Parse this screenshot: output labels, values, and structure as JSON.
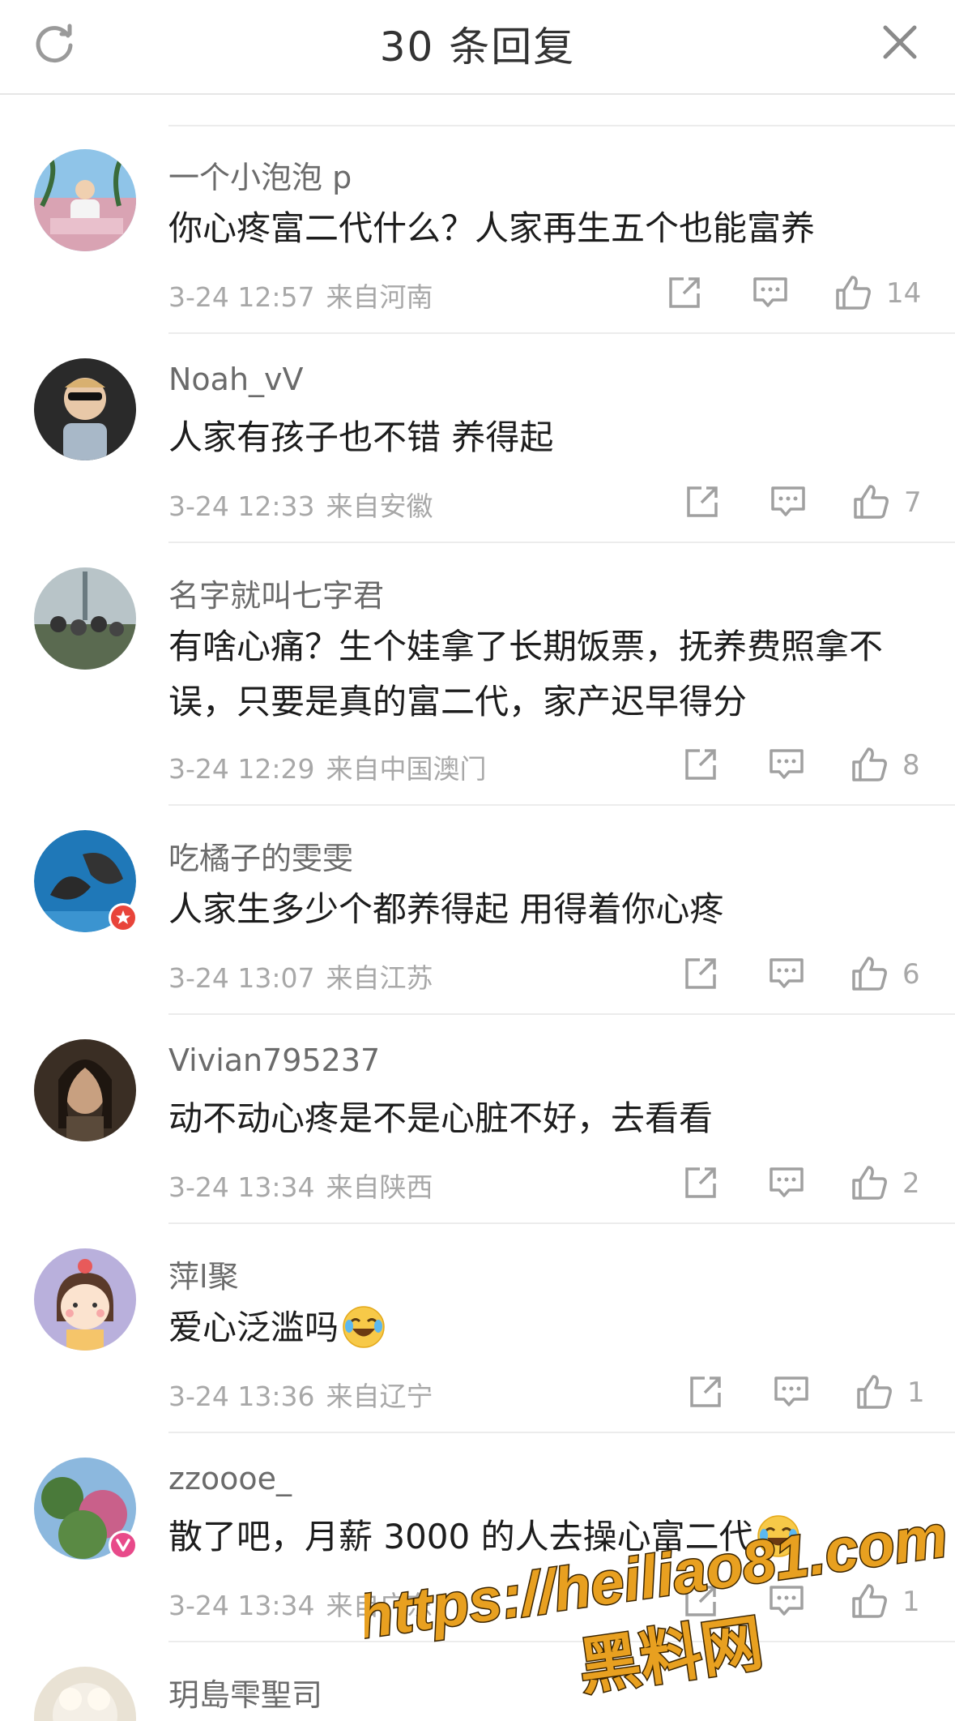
{
  "header": {
    "title": "30 条回复"
  },
  "comments": [
    {
      "user": "一个小泡泡 p",
      "text": "你心疼富二代什么？人家再生五个也能富养",
      "time": "3-24 12:57",
      "location": "来自河南",
      "likes": "14"
    },
    {
      "user": "Noah_vV",
      "text": "人家有孩子也不错 养得起",
      "time": "3-24 12:33",
      "location": "来自安徽",
      "likes": "7"
    },
    {
      "user": "名字就叫七字君",
      "text": "有啥心痛？生个娃拿了长期饭票，抚养费照拿不误，只要是真的富二代，家产迟早得分",
      "time": "3-24 12:29",
      "location": "来自中国澳门",
      "likes": "8"
    },
    {
      "user": "吃橘子的雯雯",
      "text": "人家生多少个都养得起 用得着你心疼",
      "time": "3-24 13:07",
      "location": "来自江苏",
      "likes": "6"
    },
    {
      "user": "Vivian795237",
      "text": "动不动心疼是不是心脏不好，去看看",
      "time": "3-24 13:34",
      "location": "来自陕西",
      "likes": "2"
    },
    {
      "user": "萍l聚",
      "text": "爱心泛滥吗",
      "time": "3-24 13:36",
      "location": "来自辽宁",
      "likes": "1"
    },
    {
      "user": "zzoooe_",
      "text": "散了吧，月薪 3000 的人去操心富二代",
      "time": "3-24 13:34",
      "location": "来自广东",
      "likes": "1"
    },
    {
      "user": "玥島雫聖司"
    }
  ],
  "watermark": {
    "url": "https://heiliao81.com",
    "name": "黑料网"
  },
  "icons": [
    "refresh-icon",
    "close-icon",
    "share-icon",
    "reply-icon",
    "like-icon",
    "laugh-cry-emoji-icon"
  ],
  "colors": {
    "meta": "#a8a8a8",
    "text": "#1d1d1d",
    "watermark": "#e8a020"
  }
}
